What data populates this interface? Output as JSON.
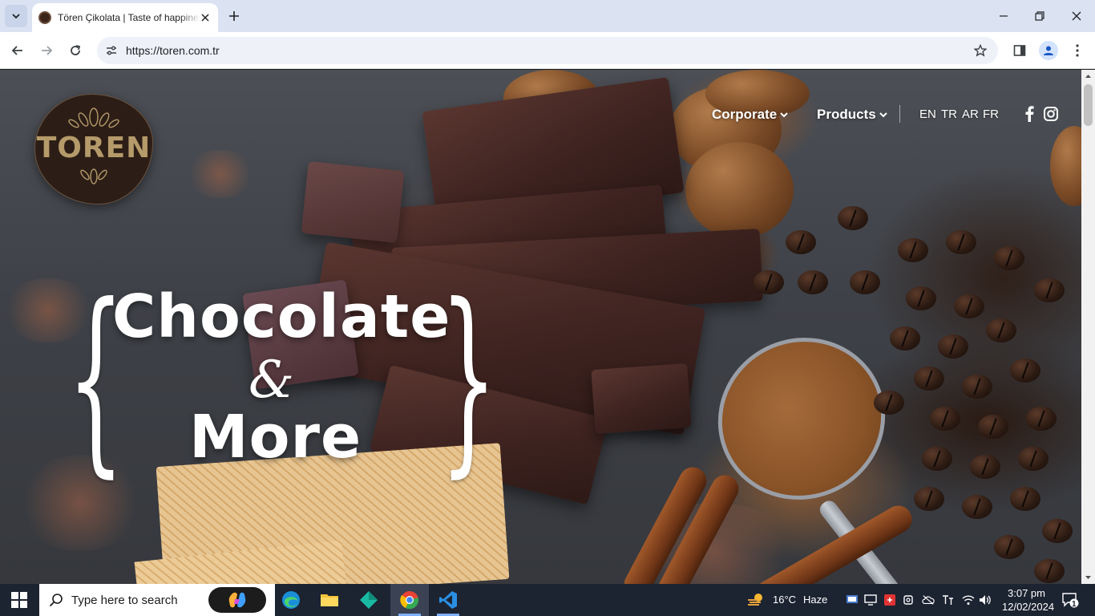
{
  "browser": {
    "tab_title": "Tören Çikolata | Taste of happiness",
    "url": "https://toren.com.tr"
  },
  "site": {
    "logo_text": "TOREN",
    "nav": {
      "corporate": "Corporate",
      "products": "Products"
    },
    "languages": [
      "EN",
      "TR",
      "AR",
      "FR"
    ],
    "social": [
      "facebook-icon",
      "instagram-icon"
    ],
    "hero": {
      "line1": "Chocolate",
      "ampersand": "&",
      "line2": "More"
    }
  },
  "taskbar": {
    "search_placeholder": "Type here to search",
    "weather_temp": "16°C",
    "weather_desc": "Haze",
    "time": "3:07 pm",
    "date": "12/02/2024",
    "notification_count": "1"
  },
  "colors": {
    "tabbar": "#dbe3f2",
    "logo_gold": "#b59a6a",
    "taskbar": "#1c2331"
  }
}
